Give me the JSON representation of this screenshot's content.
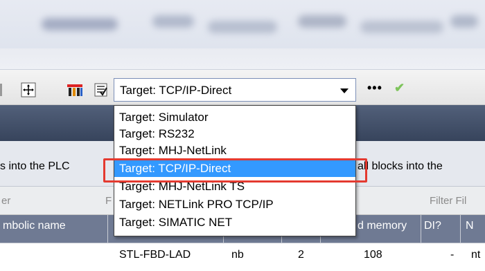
{
  "toolbar": {
    "target_value": "Target: TCP/IP-Direct",
    "more_label": "•••",
    "check_glyph": "✔"
  },
  "target_dropdown": {
    "options": [
      "Target: Simulator",
      "Target: RS232",
      "Target: MHJ-NetLink",
      "Target: TCP/IP-Direct",
      "Target: MHJ-NetLink TS",
      "Target: NETLink PRO TCP/IP",
      "Target: SIMATIC NET"
    ],
    "selected_index": 3
  },
  "info": {
    "left_text": "s into the PLC",
    "right_text": "all blocks into the"
  },
  "filter": {
    "left": "er",
    "mid": "F",
    "right": "Filter Fil"
  },
  "table": {
    "headers": [
      "mbolic name",
      "d memory",
      "DI?",
      "N"
    ],
    "row": [
      "STL-FBD-LAD",
      "nb",
      "2",
      "108",
      "-",
      "nt"
    ]
  },
  "colors": {
    "highlight": "#3399ff",
    "highlight_frame": "#e43a30",
    "header_bg": "#6f7a93",
    "dark_band": "#3f4c66"
  }
}
